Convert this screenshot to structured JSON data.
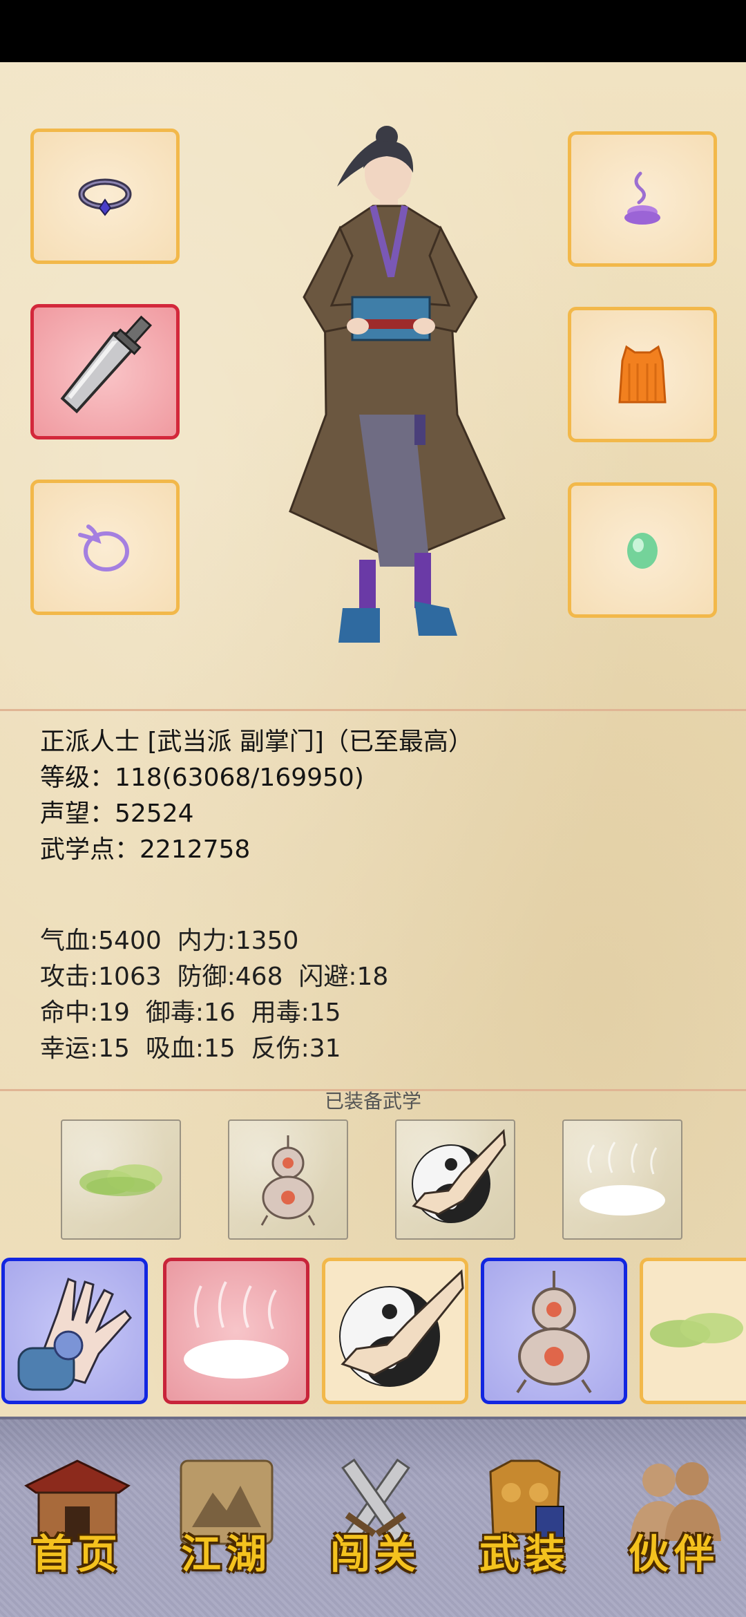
{
  "character": {
    "title_line": "正派人士 [武当派 副掌门]（已至最高）",
    "level_line": "等级：118(63068/169950)",
    "reputation_line": "声望：52524",
    "martial_points_line": "武学点：2212758"
  },
  "stats": {
    "row1": "气血:5400  内力:1350",
    "row2": "攻击:1063  防御:468  闪避:18",
    "row3": "命中:19  御毒:16  用毒:15",
    "row4": "幸运:15  吸血:15  反伤:31"
  },
  "equipment_slots": {
    "left": [
      "ring-icon",
      "broadsword-icon",
      "ribbon-icon"
    ],
    "right": [
      "incense-icon",
      "robe-icon",
      "jade-icon"
    ],
    "selected": "broadsword-icon"
  },
  "equipped_skills": {
    "title": "已装备武学",
    "icons": [
      "green-cloud-icon",
      "gourd-icon",
      "taiji-fist-icon",
      "white-mist-icon"
    ]
  },
  "skill_library": {
    "icons": [
      "palm-icon",
      "white-mist-icon",
      "taiji-fist-icon",
      "gourd-icon",
      "green-cloud-icon"
    ],
    "border_colors": [
      "#1226e0",
      "#c8243a",
      "#f2b84a",
      "#1226e0",
      "#f2b84a"
    ]
  },
  "nav": {
    "home": "首页",
    "jianghu": "江湖",
    "challenge": "闯关",
    "equipment": "武装",
    "partner": "伙伴"
  },
  "colors": {
    "slot_border": "#f2b84a",
    "selected_border": "#d3283b",
    "nav_label": "#f4c21e"
  }
}
